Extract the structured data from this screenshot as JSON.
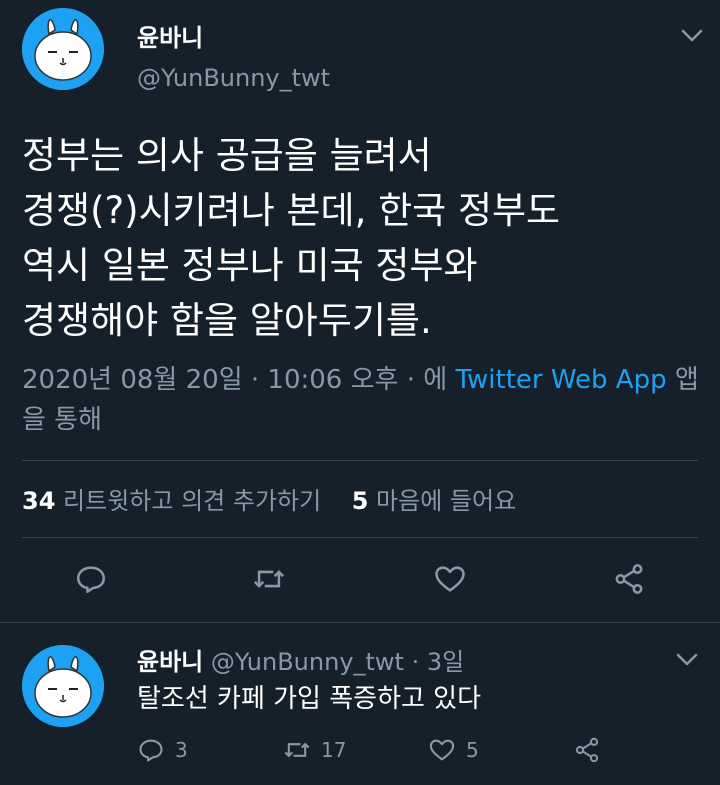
{
  "tweet": {
    "author_name": "윤바니",
    "author_handle": "@YunBunny_twt",
    "text_lines": [
      "정부는 의사 공급을 늘려서",
      "경쟁(?)시키려나 본데, 한국 정부도",
      "역시 일본 정부나 미국 정부와",
      "경쟁해야 함을 알아두기를."
    ],
    "meta_prefix": "2020년 08월 20일 · 10:06 오후 · 에 ",
    "meta_app": "Twitter Web App",
    "meta_suffix": " 앱을 통해",
    "retweet_count": "34",
    "retweet_label": "리트윗하고 의견 추가하기",
    "like_count": "5",
    "like_label": "마음에 들어요",
    "actions": [
      "reply-icon",
      "retweet-icon",
      "like-icon",
      "share-icon"
    ]
  },
  "reply": {
    "author_name": "윤바니",
    "author_handle": "@YunBunny_twt · 3일",
    "text": "탈조선 카페 가입 폭증하고 있다",
    "reply_count": "3",
    "retweet_count": "17",
    "like_count": "5"
  },
  "colors": {
    "background": "#15202b",
    "accent": "#1da1f2",
    "muted": "#8899a6",
    "divider": "#38444d"
  }
}
